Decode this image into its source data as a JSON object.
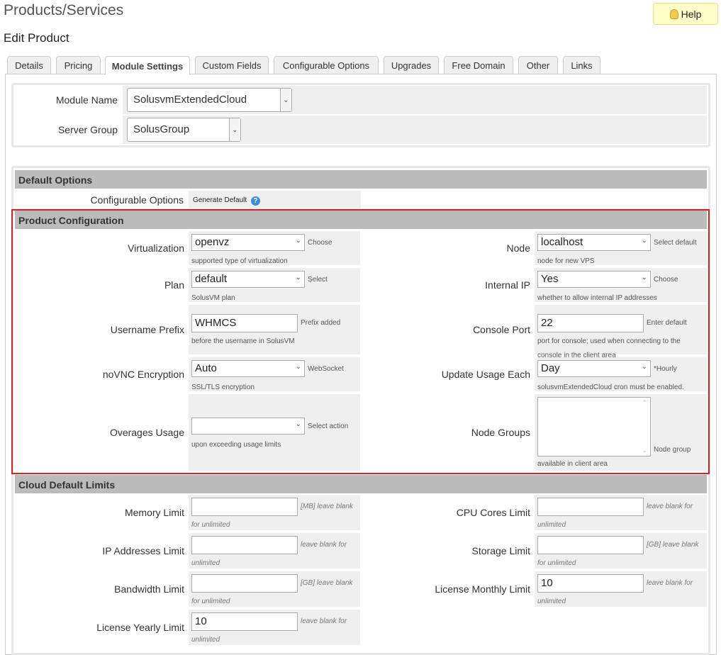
{
  "page_title": "Products/Services",
  "subtitle": "Edit Product",
  "help_label": "Help",
  "tabs": [
    "Details",
    "Pricing",
    "Module Settings",
    "Custom Fields",
    "Configurable Options",
    "Upgrades",
    "Free Domain",
    "Other",
    "Links"
  ],
  "active_tab": "Module Settings",
  "module": {
    "name_label": "Module Name",
    "name_value": "SolusvmExtendedCloud",
    "group_label": "Server Group",
    "group_value": "SolusGroup"
  },
  "default_options": {
    "header": "Default Options",
    "label": "Configurable Options",
    "link": "Generate Default"
  },
  "product_config": {
    "header": "Product Configuration",
    "left": [
      {
        "label": "Virtualization",
        "value": "openvz",
        "type": "select",
        "hint1": "Choose",
        "hint2": "supported type of virtualization"
      },
      {
        "label": "Plan",
        "value": "default",
        "type": "select",
        "hint1": "Select",
        "hint2": "SolusVM plan"
      },
      {
        "label": "Username Prefix",
        "value": "WHMCS",
        "type": "input",
        "hint1": "Prefix added",
        "hint2": "before the username in SolusVM"
      },
      {
        "label": "noVNC Encryption",
        "value": "Auto",
        "type": "select",
        "hint1": "WebSocket",
        "hint2": "SSL/TLS encryption"
      },
      {
        "label": "Overages Usage",
        "value": "",
        "type": "select",
        "hint1": "Select action",
        "hint2": "upon exceeding usage limits"
      }
    ],
    "right": [
      {
        "label": "Node",
        "value": "localhost",
        "type": "select",
        "hint1": "Select default",
        "hint2": "node for new VPS"
      },
      {
        "label": "Internal IP",
        "value": "Yes",
        "type": "select",
        "hint1": "Choose",
        "hint2": "whether to allow internal IP addresses"
      },
      {
        "label": "Console Port",
        "value": "22",
        "type": "input",
        "hint1": "Enter default",
        "hint2": "port for console; used when connecting to the",
        "hint3": "console in the client area"
      },
      {
        "label": "Update Usage Each",
        "value": "Day",
        "type": "select",
        "hint1": "*Hourly",
        "hint2": "solusvmExtendedCloud cron must be enabled."
      },
      {
        "label": "Node Groups",
        "value": "",
        "type": "multiselect",
        "hint1": "Node group",
        "hint2": "available in client area"
      }
    ]
  },
  "cloud_limits": {
    "header": "Cloud Default Limits",
    "left": [
      {
        "label": "Memory Limit",
        "value": "",
        "hint1": "[MB] leave blank",
        "hint2": "for unlimited"
      },
      {
        "label": "IP Addresses Limit",
        "value": "",
        "hint1": "leave blank for",
        "hint2": "unlimited"
      },
      {
        "label": "Bandwidth Limit",
        "value": "",
        "hint1": "[GB] leave blank",
        "hint2": "for unlimited"
      },
      {
        "label": "License Yearly Limit",
        "value": "10",
        "hint1": "leave blank for",
        "hint2": "unlimited"
      }
    ],
    "right": [
      {
        "label": "CPU Cores Limit",
        "value": "",
        "hint1": "leave blank for",
        "hint2": "unlimited"
      },
      {
        "label": "Storage Limit",
        "value": "",
        "hint1": "[GB] leave blank",
        "hint2": "for unlimited"
      },
      {
        "label": "License Monthly Limit",
        "value": "10",
        "hint1": "leave blank for",
        "hint2": "unlimited"
      }
    ]
  },
  "colors": {
    "highlight_border": "#e41b23",
    "header_bg": "#bbbbbb",
    "cell_bg": "#efefef",
    "help_bg": "#ffffc9"
  }
}
